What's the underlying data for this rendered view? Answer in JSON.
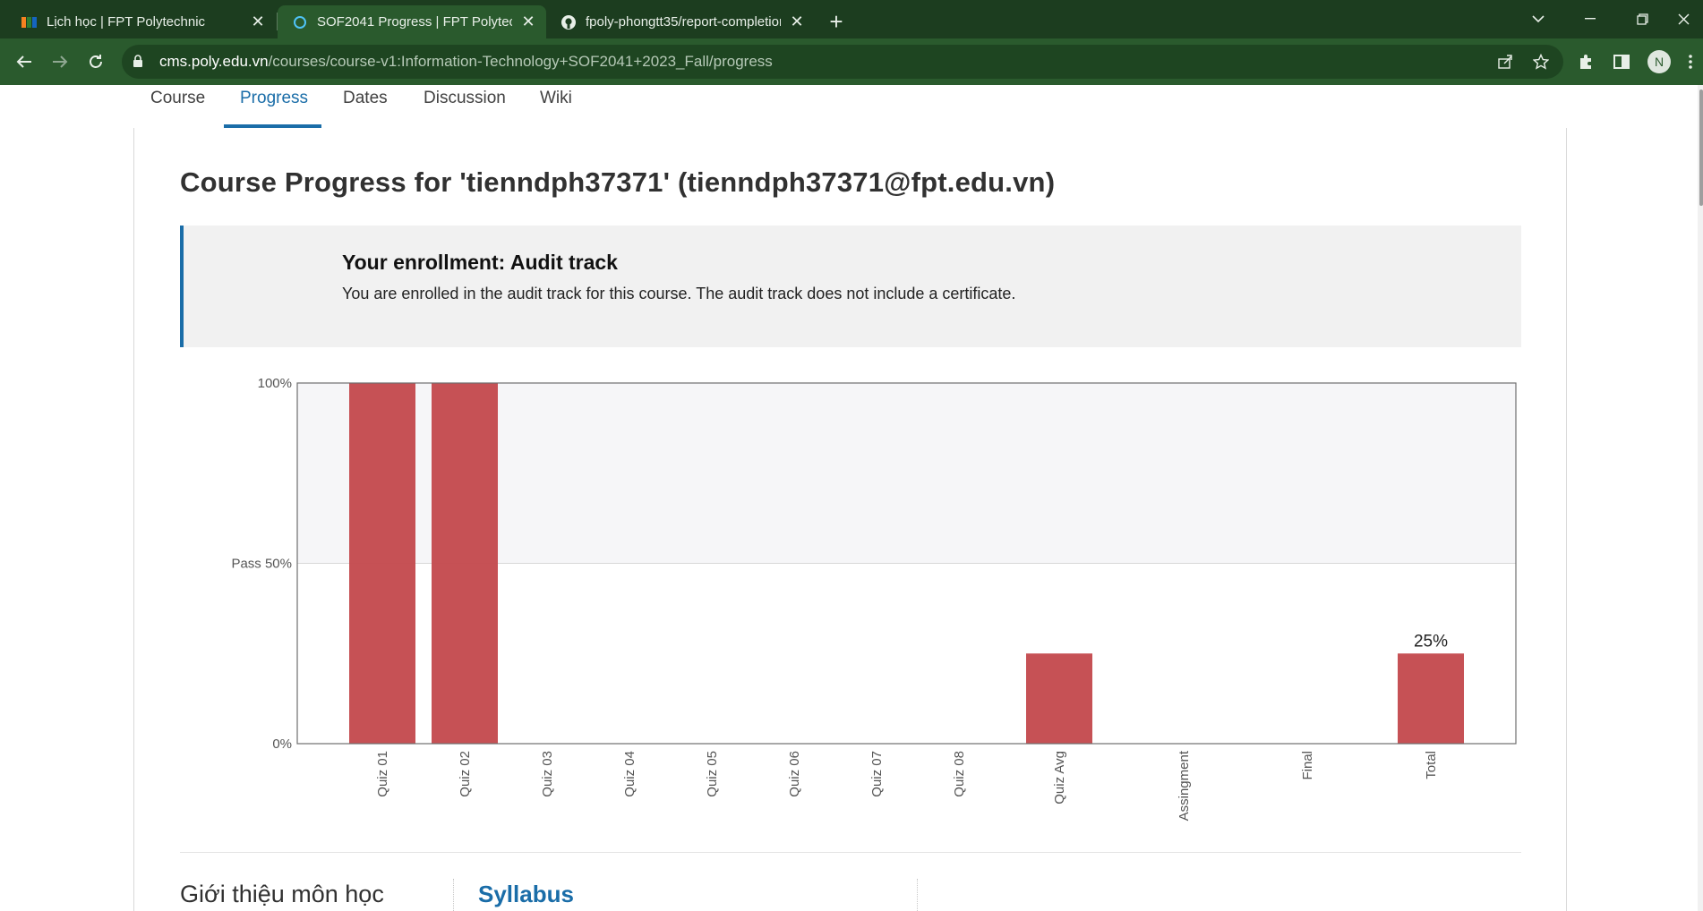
{
  "browser": {
    "tabs": [
      {
        "title": "Lịch học | FPT Polytechnic",
        "icon": "fpt-logo-icon",
        "active": false
      },
      {
        "title": "SOF2041 Progress | FPT Polytechnic",
        "icon": "loading-ring-icon",
        "active": true
      },
      {
        "title": "fpoly-phongtt35/report-completion",
        "icon": "github-icon",
        "active": false
      }
    ],
    "url_host": "cms.poly.edu.vn",
    "url_path": "/courses/course-v1:Information-Technology+SOF2041+2023_Fall/progress",
    "profile_initial": "N"
  },
  "course_nav": {
    "items": [
      "Course",
      "Progress",
      "Dates",
      "Discussion",
      "Wiki"
    ],
    "active": "Progress"
  },
  "page": {
    "title": "Course Progress for 'tienndph37371' (tienndph37371@fpt.edu.vn)"
  },
  "enrollment": {
    "heading": "Your enrollment: Audit track",
    "text": "You are enrolled in the audit track for this course. The audit track does not include a certificate."
  },
  "chart_data": {
    "type": "bar",
    "categories": [
      "Quiz 01",
      "Quiz 02",
      "Quiz 03",
      "Quiz 04",
      "Quiz 05",
      "Quiz 06",
      "Quiz 07",
      "Quiz 08",
      "Quiz Avg",
      "Assingment",
      "Final",
      "Total"
    ],
    "values": [
      100,
      100,
      0,
      0,
      0,
      0,
      0,
      0,
      25,
      0,
      0,
      25
    ],
    "ylim": [
      0,
      100
    ],
    "y_ticks": [
      {
        "value": 0,
        "label": "0%"
      },
      {
        "value": 50,
        "label": "Pass 50%"
      },
      {
        "value": 100,
        "label": "100%"
      }
    ],
    "pass_threshold": 50,
    "data_labels": [
      {
        "category": "Total",
        "label": "25%"
      }
    ],
    "bar_color": "#c44b4f",
    "pass_region_color": "#f6f6f8"
  },
  "sections": {
    "intro_title": "Giới thiệu môn học",
    "syllabus_link": "Syllabus"
  },
  "colors": {
    "accent": "#1a6da8",
    "chrome_dark": "#1c3d1f",
    "chrome_toolbar": "#2a5a2d"
  }
}
